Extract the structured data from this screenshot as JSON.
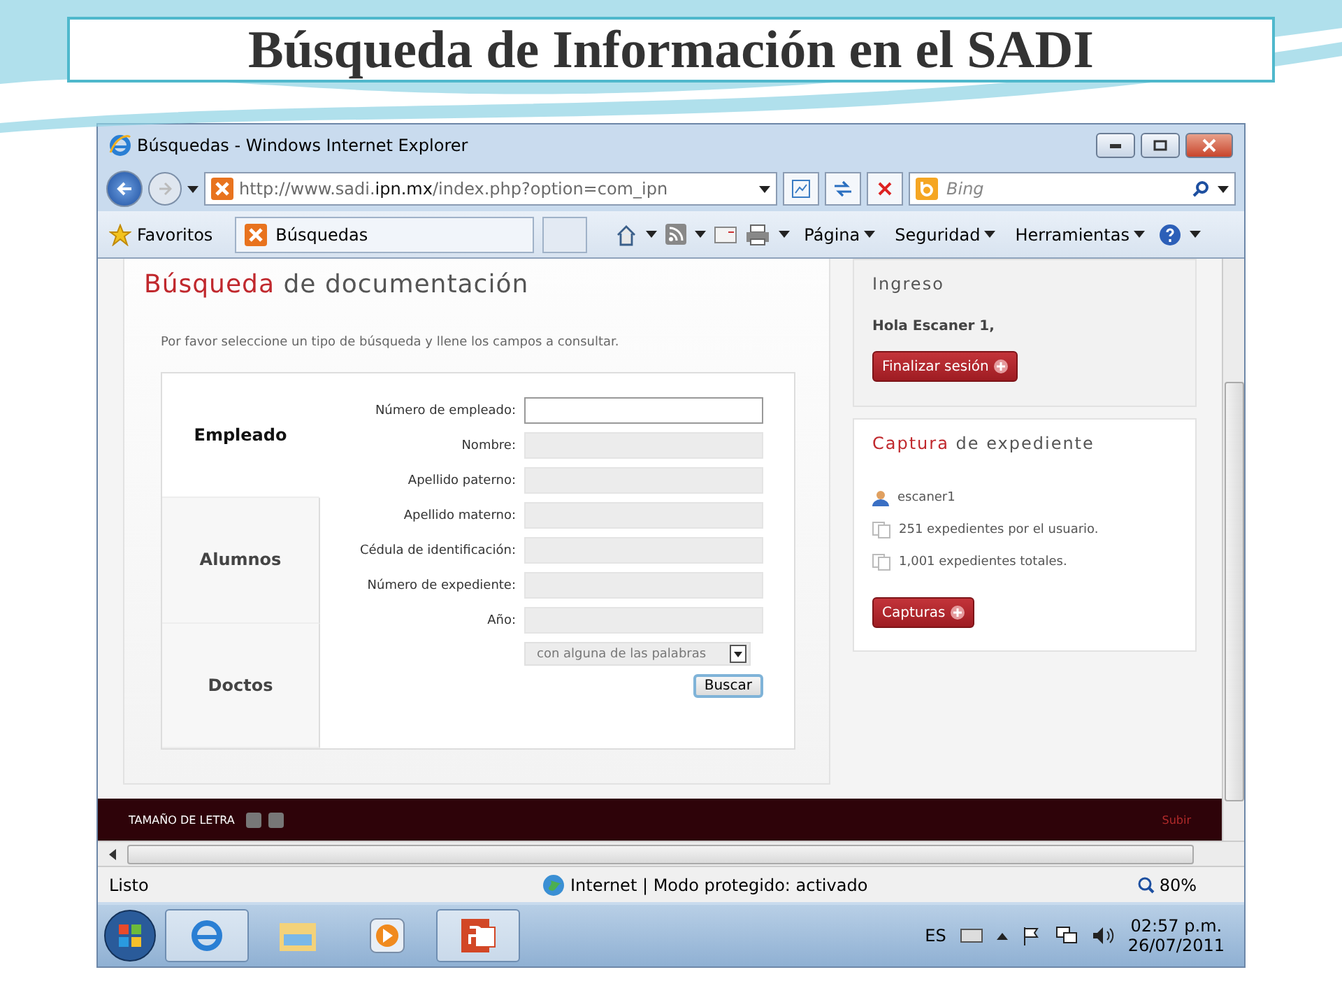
{
  "slide_title": "Búsqueda de Información en el SADI",
  "browser": {
    "title": "Búsquedas - Windows Internet Explorer",
    "address": {
      "pre": "http://www.sadi.",
      "host": "ipn.mx",
      "post": "/index.php?option=com_ipn"
    },
    "search_placeholder": "Bing",
    "favorites": "Favoritos",
    "tab": "Búsquedas",
    "commands": [
      "Página",
      "Seguridad",
      "Herramientas"
    ]
  },
  "page": {
    "heading": {
      "accent": "Búsqueda",
      "rest": "de documentación"
    },
    "instructions": "Por favor seleccione un tipo de búsqueda y llene los campos a consultar.",
    "tabs": [
      {
        "label": "Empleado",
        "selected": true
      },
      {
        "label": "Alumnos",
        "selected": false
      },
      {
        "label": "Doctos",
        "selected": false
      }
    ],
    "fields": [
      {
        "label": "Número de empleado:",
        "focused": true
      },
      {
        "label": "Nombre:",
        "focused": false
      },
      {
        "label": "Apellido paterno:",
        "focused": false
      },
      {
        "label": "Apellido materno:",
        "focused": false
      },
      {
        "label": "Cédula de identificación:",
        "focused": false
      },
      {
        "label": "Número de expediente:",
        "focused": false
      },
      {
        "label": "Año:",
        "focused": false
      }
    ],
    "match_select": "con alguna de las palabras",
    "search_button": "Buscar"
  },
  "sidebar": {
    "login": {
      "title": "Ingreso",
      "greeting": "Hola Escaner 1,",
      "button": "Finalizar sesión"
    },
    "capture": {
      "title": {
        "accent": "Captura",
        "rest": "de expediente"
      },
      "items": [
        {
          "kind": "user",
          "text": "escaner1"
        },
        {
          "kind": "docs",
          "text": "251 expedientes por el usuario."
        },
        {
          "kind": "docs",
          "text": "1,001 expedientes totales."
        }
      ],
      "button": "Capturas"
    }
  },
  "footer": {
    "font_size_label": "TAMAÑO DE LETRA",
    "up_link": "Subir"
  },
  "status_bar": {
    "status": "Listo",
    "zone": "Internet | Modo protegido: activado",
    "zoom": "80%"
  },
  "taskbar": {
    "language": "ES",
    "time": "02:57 p.m.",
    "date": "26/07/2011"
  }
}
